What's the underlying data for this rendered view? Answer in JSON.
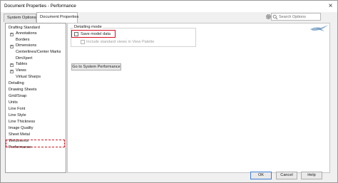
{
  "window": {
    "title": "Document Properties - Performance",
    "close_glyph": "×"
  },
  "tabs": [
    {
      "label": "System Options"
    },
    {
      "label": "Document Properties"
    }
  ],
  "search": {
    "placeholder": "Search Options"
  },
  "tree": {
    "items": [
      {
        "label": "Drafting Standard",
        "expander": false
      },
      {
        "label": "Annotations",
        "expander": true
      },
      {
        "label": "Borders",
        "expander": false
      },
      {
        "label": "Dimensions",
        "expander": true
      },
      {
        "label": "Centerlines/Center Marks",
        "expander": false
      },
      {
        "label": "DimXpert",
        "expander": false
      },
      {
        "label": "Tables",
        "expander": true
      },
      {
        "label": "Views",
        "expander": true
      },
      {
        "label": "Virtual Sharps",
        "expander": false
      },
      {
        "label": "Detailing",
        "expander": false
      },
      {
        "label": "Drawing Sheets",
        "expander": false
      },
      {
        "label": "Grid/Snap",
        "expander": false
      },
      {
        "label": "Units",
        "expander": false
      },
      {
        "label": "Line Font",
        "expander": false
      },
      {
        "label": "Line Style",
        "expander": false
      },
      {
        "label": "Line Thickness",
        "expander": false
      },
      {
        "label": "Image Quality",
        "expander": false
      },
      {
        "label": "Sheet Metal",
        "expander": false
      },
      {
        "label": "Weldments",
        "expander": false
      },
      {
        "label": "Performance",
        "expander": false
      }
    ],
    "expander_glyph": "+"
  },
  "detailing": {
    "group_title": "Detailing mode",
    "save_model_data": {
      "label": "Save model data",
      "checked": false
    },
    "include_standard_views": {
      "label": "Include standard views in View Palette",
      "checked": false,
      "disabled": true
    },
    "go_to_system_button": "Go to System Performance"
  },
  "footer": {
    "ok": "OK",
    "cancel": "Cancel",
    "help": "Help"
  },
  "colors": {
    "highlight": "#d81020",
    "accent": "#3c7fd8"
  },
  "icons": [
    "close-icon",
    "gear-icon",
    "search-icon",
    "expander-icon",
    "solidworks-logo-icon"
  ]
}
